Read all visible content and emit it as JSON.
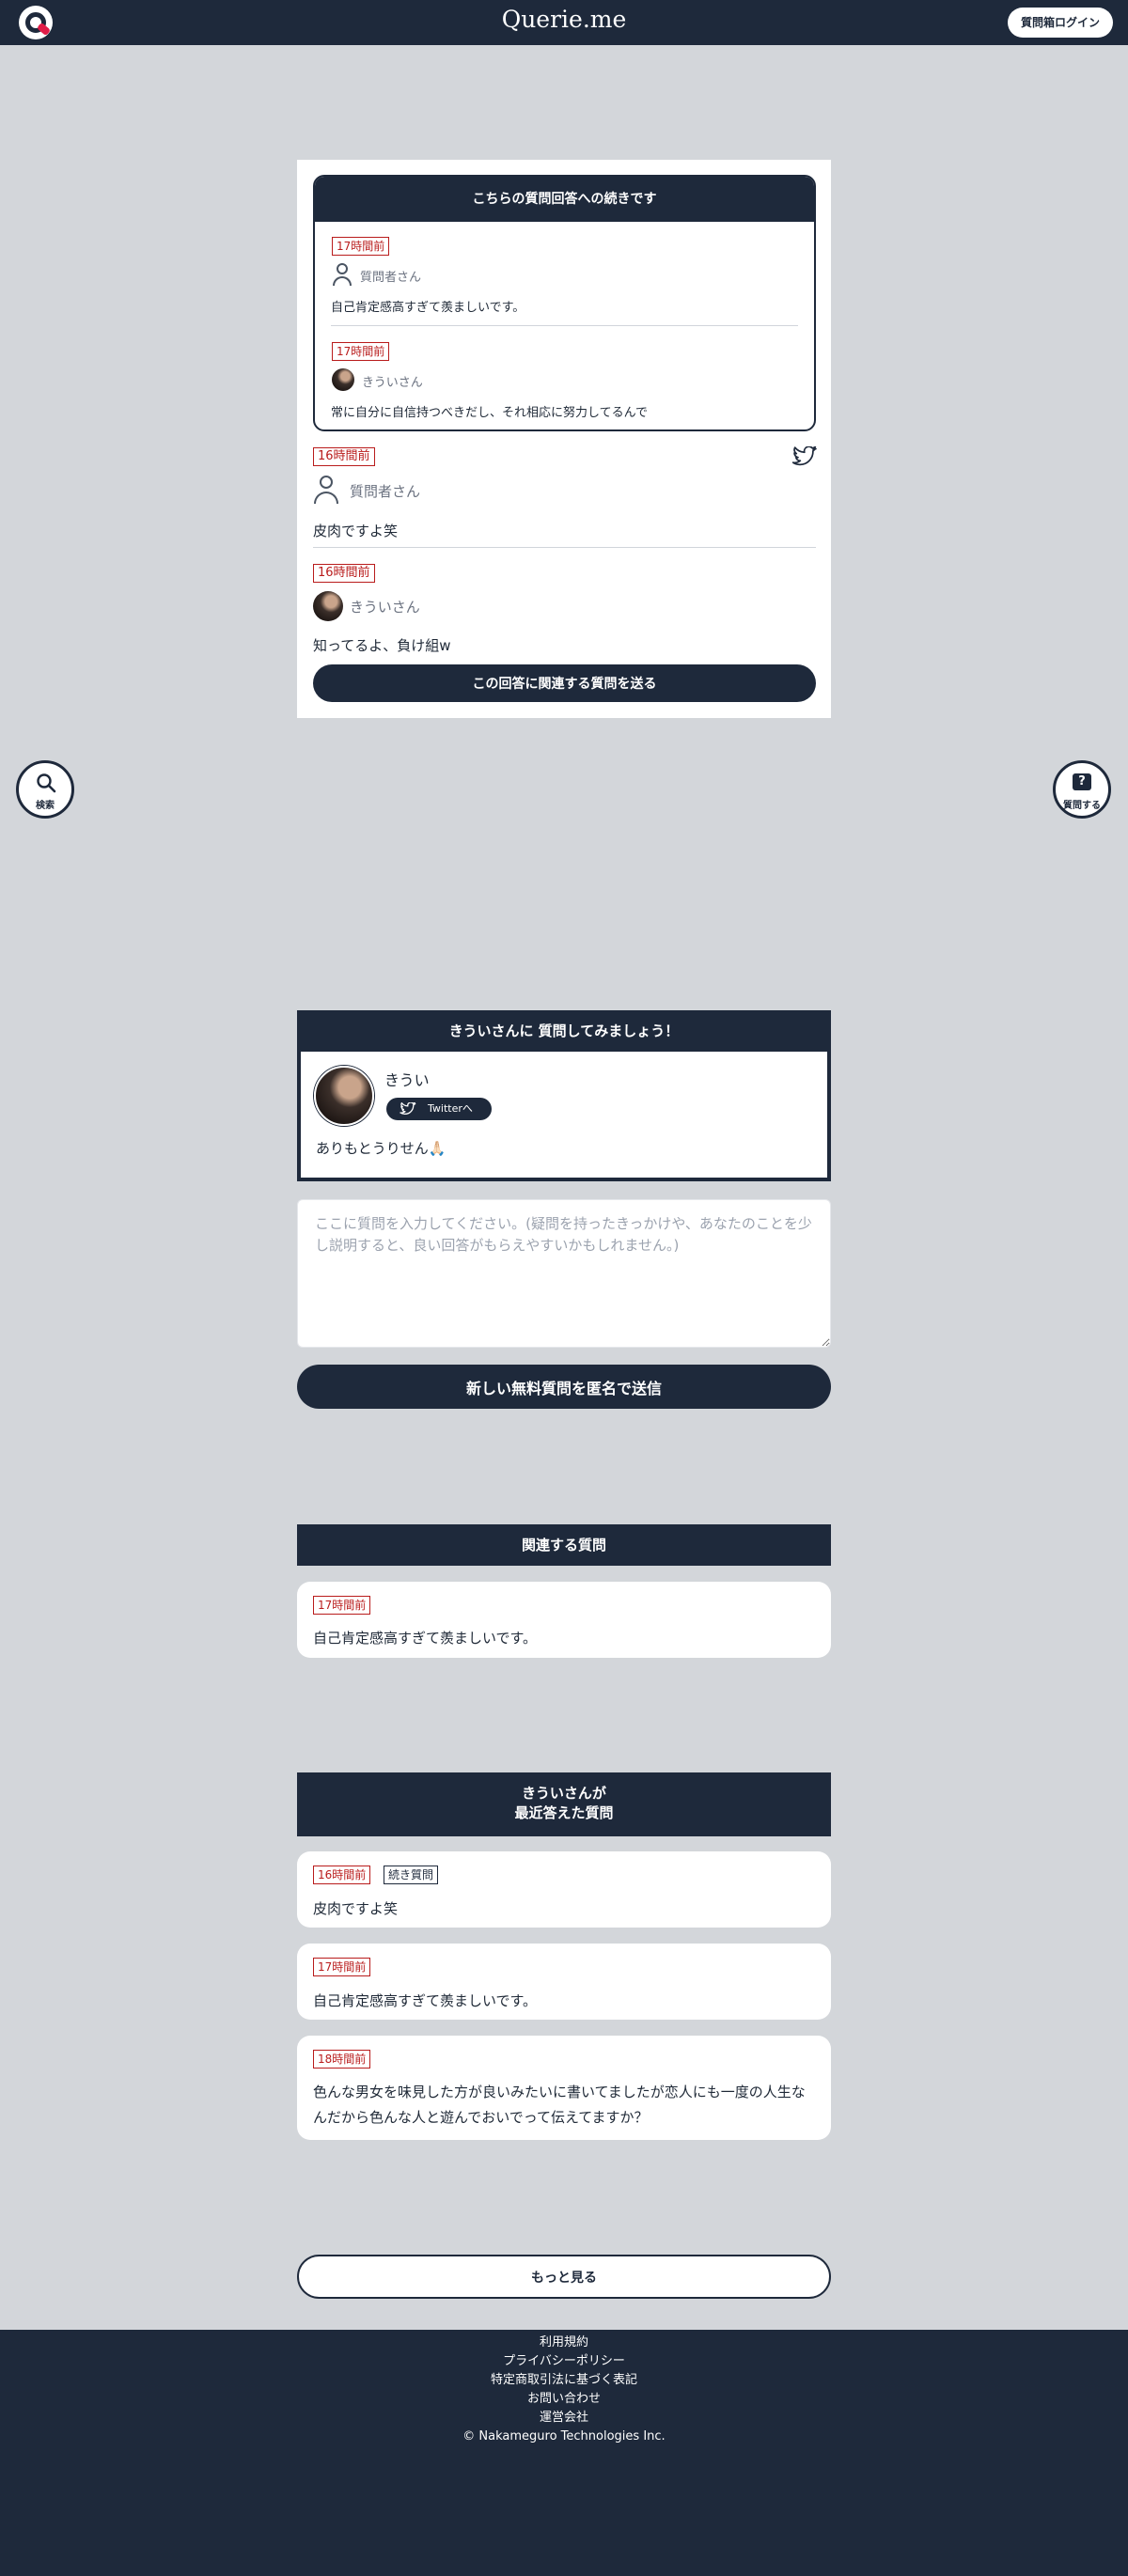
{
  "header": {
    "brand": "Querie.me",
    "login_label": "質問箱ログイン"
  },
  "continuation": {
    "title": "こちらの質問回答への続きです",
    "items": [
      {
        "time": "17時間前",
        "who": "質問者さん",
        "text": "自己肯定感高すぎて羨ましいです。"
      },
      {
        "time": "17時間前",
        "who": "きういさん",
        "text": "常に自分に自信持つべきだし、それ相応に努力してるんで"
      }
    ]
  },
  "current": {
    "question": {
      "time": "16時間前",
      "who": "質問者さん",
      "text": "皮肉ですよ笑"
    },
    "answer": {
      "time": "16時間前",
      "who": "きういさん",
      "text": "知ってるよ、負け組w"
    },
    "related_button": "この回答に関連する質問を送る"
  },
  "side": {
    "search_label": "検索",
    "ask_label": "質問する",
    "ask_glyph": "?"
  },
  "profile": {
    "title": "きういさんに 質問してみましょう！",
    "name": "きうい",
    "twitter_label": "Twitterへ",
    "bio": "ありもとうりせん🙏🏻"
  },
  "form": {
    "placeholder": "ここに質問を入力してください。(疑問を持ったきっかけや、あなたのことを少し説明すると、良い回答がもらえやすいかもしれません。)",
    "submit_label": "新しい無料質問を匿名で送信"
  },
  "related": {
    "title": "関連する質問",
    "items": [
      {
        "time": "17時間前",
        "text": "自己肯定感高すぎて羨ましいです。"
      }
    ]
  },
  "recent": {
    "title_line1": "きういさんが",
    "title_line2": "最近答えた質問",
    "items": [
      {
        "time": "16時間前",
        "tag": "続き質問",
        "text": "皮肉ですよ笑"
      },
      {
        "time": "17時間前",
        "text": "自己肯定感高すぎて羨ましいです。"
      },
      {
        "time": "18時間前",
        "text": "色んな男女を味見した方が良いみたいに書いてましたが恋人にも一度の人生なんだから色んな人と遊んでおいでって伝えてますか？"
      }
    ],
    "more_label": "もっと見る"
  },
  "footer": {
    "links": [
      "利用規約",
      "プライバシーポリシー",
      "特定商取引法に基づく表記",
      "お問い合わせ",
      "運営会社"
    ],
    "copyright": "© Nakameguro Technologies Inc."
  },
  "colors": {
    "navy": "#1e293b",
    "badge_red": "#b91c1c",
    "background": "#d3d6da"
  }
}
